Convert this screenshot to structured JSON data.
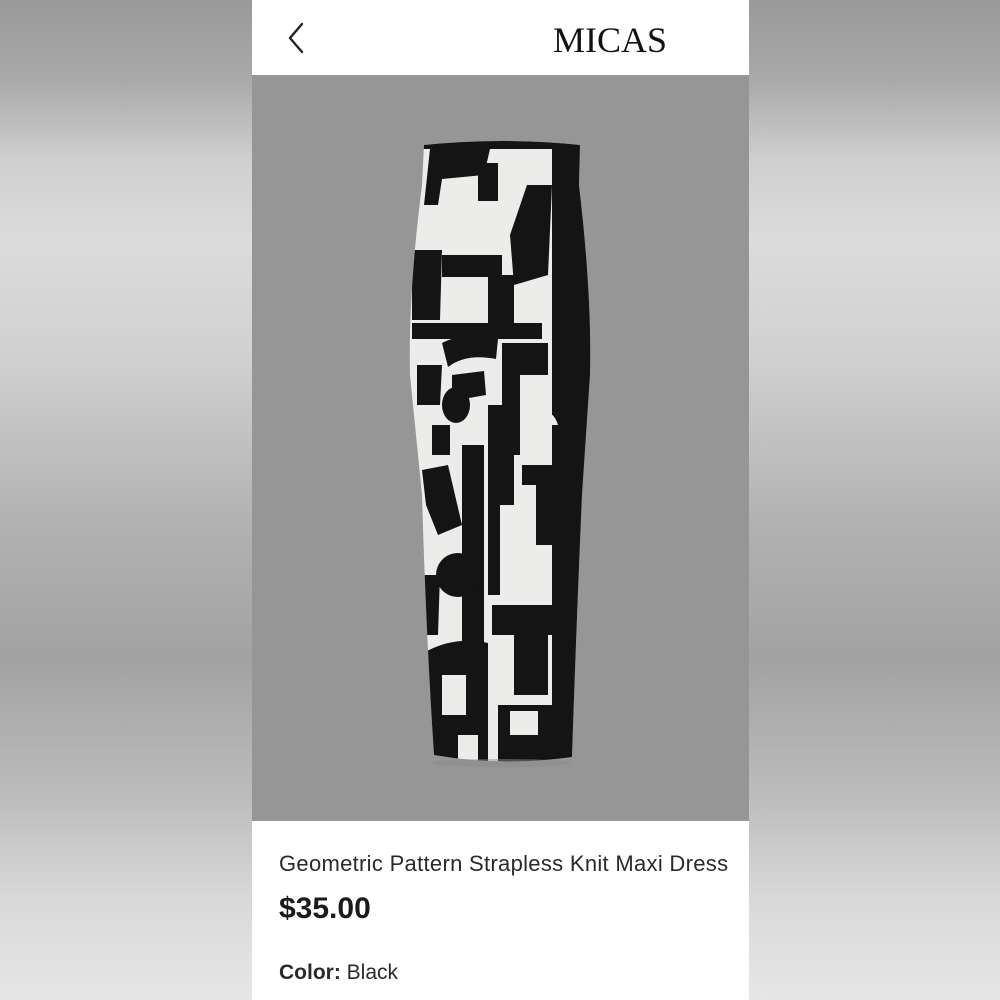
{
  "header": {
    "back_icon": "chevron-left-icon",
    "logo": "MICAS"
  },
  "product": {
    "image": "geometric-pattern-strapless-dress-image",
    "title": "Geometric Pattern Strapless Knit Maxi Dress",
    "price": "$35.00",
    "color_label": "Color:",
    "color_value": "Black"
  },
  "colors": {
    "page_bg": "#ffffff",
    "hero_bg": "#969696",
    "dress_black": "#141414",
    "dress_white": "#ececea"
  }
}
